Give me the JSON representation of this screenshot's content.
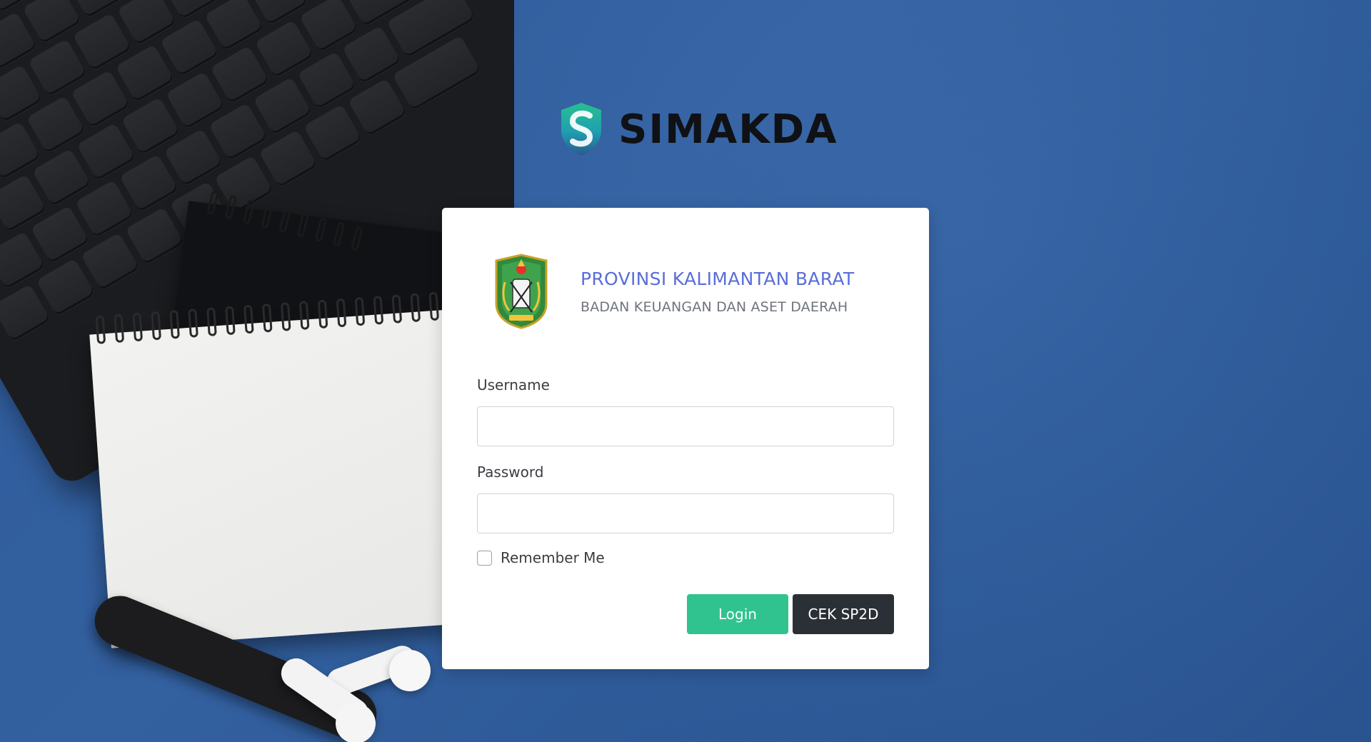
{
  "brand": {
    "name": "SIMAKDA",
    "mark_icon": "shield-s-logo-icon",
    "colors": {
      "mark_top": "#1f9fb0",
      "mark_bottom": "#2a5b8f"
    }
  },
  "org": {
    "title": "PROVINSI KALIMANTAN BARAT",
    "subtitle": "BADAN KEUANGAN DAN ASET DAERAH",
    "crest_icon": "provincial-crest-icon"
  },
  "form": {
    "username_label": "Username",
    "username_value": "",
    "password_label": "Password",
    "password_value": "",
    "remember_label": "Remember Me",
    "remember_checked": false
  },
  "actions": {
    "login_label": "Login",
    "cek_label": "CEK SP2D"
  },
  "colors": {
    "background": "#2f5c9c",
    "title_accent": "#5a6ed8",
    "login_button": "#30c38f",
    "cek_button": "#2b3036"
  }
}
